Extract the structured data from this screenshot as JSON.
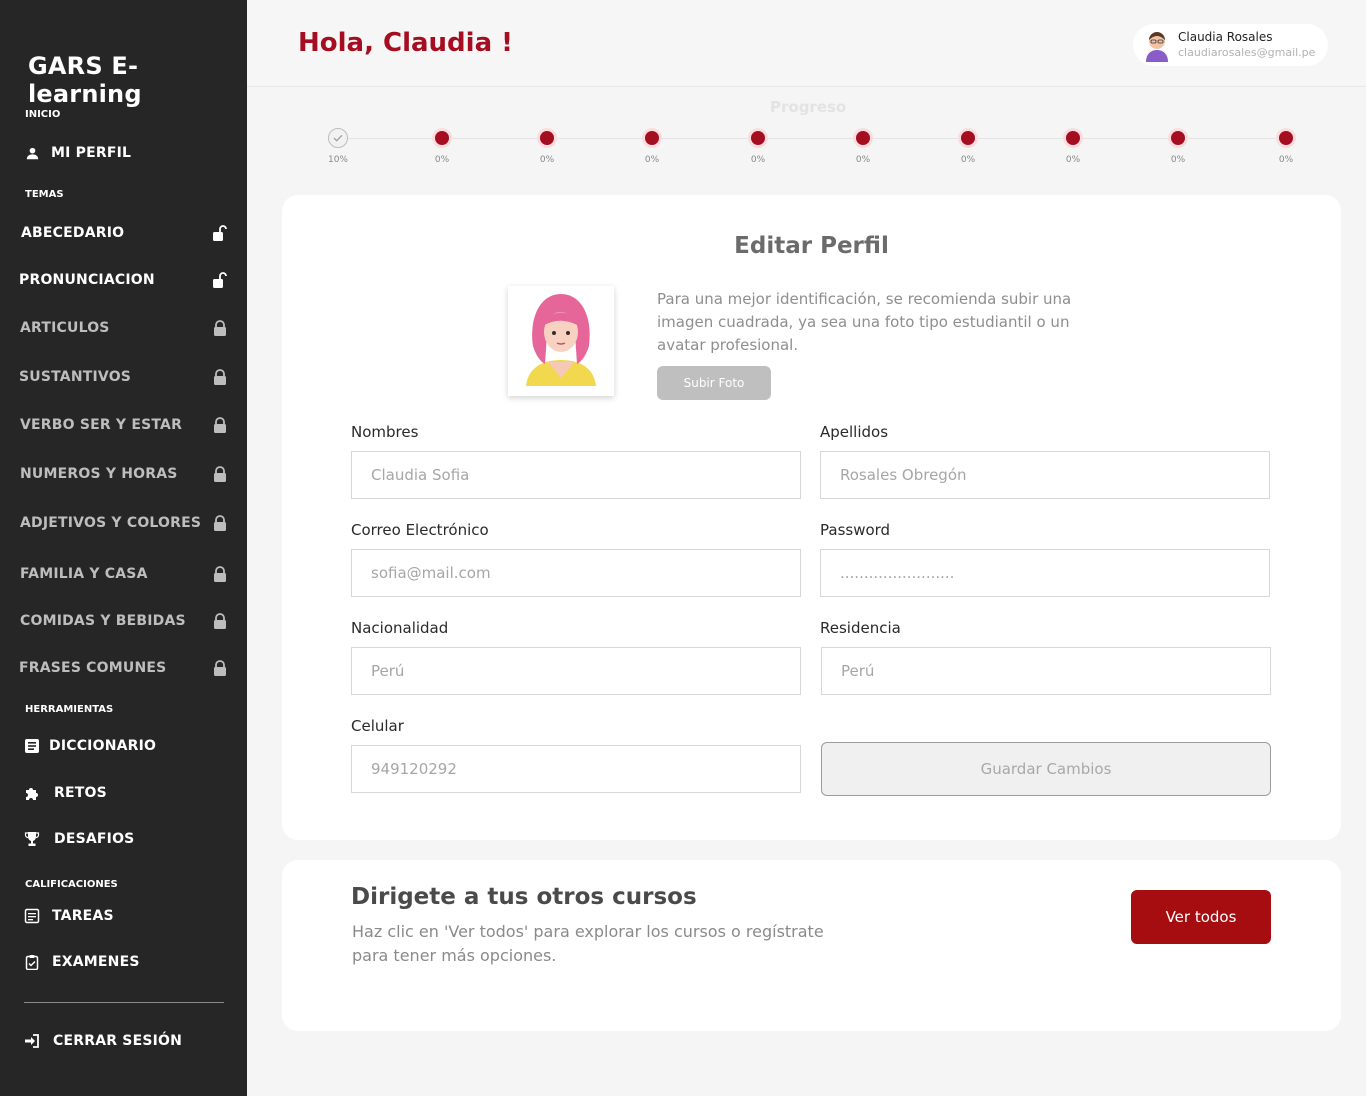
{
  "sidebar": {
    "brand": "GARS E-learning",
    "sections": {
      "inicio": "INICIO",
      "temas": "TEMAS",
      "herramientas": "HERRAMIENTAS",
      "calificaciones": "CALIFICACIONES"
    },
    "profile_label": "MI PERFIL",
    "topics": [
      {
        "label": "ABECEDARIO",
        "status": "unlocked"
      },
      {
        "label": "PRONUNCIACION",
        "status": "unlocked"
      },
      {
        "label": "ARTICULOS",
        "status": "locked"
      },
      {
        "label": "SUSTANTIVOS",
        "status": "locked"
      },
      {
        "label": "VERBO SER Y ESTAR",
        "status": "locked"
      },
      {
        "label": "NUMEROS Y HORAS",
        "status": "locked"
      },
      {
        "label": "ADJETIVOS Y COLORES",
        "status": "locked"
      },
      {
        "label": "FAMILIA Y CASA",
        "status": "locked"
      },
      {
        "label": "COMIDAS Y BEBIDAS",
        "status": "locked"
      },
      {
        "label": "FRASES COMUNES",
        "status": "locked"
      }
    ],
    "tools": {
      "diccionario": "DICCIONARIO",
      "retos": "RETOS",
      "desafios": "DESAFIOS"
    },
    "grades": {
      "tareas": "TAREAS",
      "examenes": "EXAMENES"
    },
    "logout": "CERRAR SESIÓN"
  },
  "header": {
    "greeting": "Hola, Claudia !",
    "user_name": "Claudia Rosales",
    "user_email": "claudiarosales@gmail.pe"
  },
  "progress": {
    "title": "Progreso",
    "steps": [
      {
        "pct": "10%",
        "done": true
      },
      {
        "pct": "0%",
        "done": false
      },
      {
        "pct": "0%",
        "done": false
      },
      {
        "pct": "0%",
        "done": false
      },
      {
        "pct": "0%",
        "done": false
      },
      {
        "pct": "0%",
        "done": false
      },
      {
        "pct": "0%",
        "done": false
      },
      {
        "pct": "0%",
        "done": false
      },
      {
        "pct": "0%",
        "done": false
      },
      {
        "pct": "0%",
        "done": false
      }
    ]
  },
  "profile_form": {
    "title": "Editar Perfil",
    "photo_hint": "Para una mejor identificación, se recomienda subir una imagen cuadrada, ya sea una foto tipo estudiantil o un avatar profesional.",
    "upload_label": "Subir Foto",
    "nombres_label": "Nombres",
    "nombres_placeholder": "Claudia Sofia",
    "apellidos_label": "Apellidos",
    "apellidos_placeholder": "Rosales Obregón",
    "correo_label": "Correo Electrónico",
    "correo_placeholder": "sofia@mail.com",
    "password_label": "Password",
    "password_placeholder": "........................",
    "nacionalidad_label": "Nacionalidad",
    "nacionalidad_placeholder": "Perú",
    "residencia_label": "Residencia",
    "residencia_placeholder": "Perú",
    "celular_label": "Celular",
    "celular_placeholder": "949120292",
    "save_label": "Guardar Cambios"
  },
  "promo": {
    "title": "Dirigete a tus otros cursos",
    "text": "Haz clic en 'Ver todos' para explorar los cursos o regístrate para tener más opciones.",
    "button_label": "Ver todos"
  },
  "colors": {
    "brand_red": "#a50d20",
    "sidebar_bg": "#262626",
    "button_red": "#a50d10"
  }
}
